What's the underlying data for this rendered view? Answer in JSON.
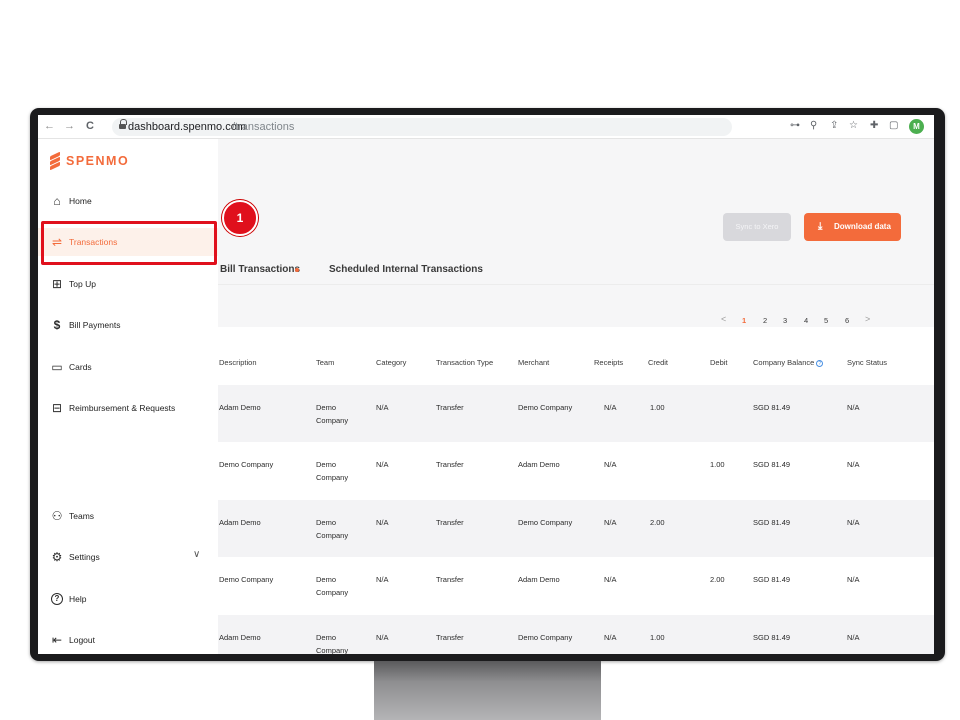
{
  "browser": {
    "url_domain": "dashboard.spenmo.com",
    "url_path": "/transactions",
    "back_glyph": "←",
    "forward_glyph": "→",
    "reload_glyph": "C",
    "profile_initial": "M",
    "key_glyph": "⊶",
    "zoom_glyph": "⚲",
    "share_glyph": "⇪",
    "star_glyph": "☆",
    "ext_glyph": "✚",
    "window_glyph": "▢"
  },
  "brand": {
    "name": "SPENMO",
    "color": "#f36b3b"
  },
  "sidebar": {
    "items": [
      {
        "label": "Home",
        "icon": "home-icon",
        "glyph": "⌂"
      },
      {
        "label": "Transactions",
        "icon": "transfer-arrows-icon",
        "glyph": "⇌",
        "active": true
      },
      {
        "label": "Top Up",
        "icon": "top-up-icon",
        "glyph": "⊞"
      },
      {
        "label": "Bill Payments",
        "icon": "bill-icon",
        "glyph": "$"
      },
      {
        "label": "Cards",
        "icon": "card-icon",
        "glyph": "▭"
      },
      {
        "label": "Reimbursement & Requests",
        "icon": "reimbursement-icon",
        "glyph": "⊟"
      }
    ],
    "bottom_items": [
      {
        "label": "Teams",
        "icon": "teams-icon",
        "glyph": "⚇"
      },
      {
        "label": "Settings",
        "icon": "settings-icon",
        "glyph": "⚙",
        "chevron": "∨"
      },
      {
        "label": "Help",
        "icon": "help-icon",
        "glyph": "?"
      },
      {
        "label": "Logout",
        "icon": "logout-icon",
        "glyph": "⇤"
      }
    ]
  },
  "header": {
    "sync_label": "Sync to Xero",
    "download_label": "Download data",
    "download_glyph": "⤓"
  },
  "tabs": [
    {
      "label": "Bill Transactions"
    },
    {
      "label": "Scheduled Internal Transactions"
    }
  ],
  "pagination": {
    "prev": "<",
    "next": ">",
    "pages": [
      "1",
      "2",
      "3",
      "4",
      "5",
      "6"
    ],
    "current": "1"
  },
  "table": {
    "columns": [
      "Description",
      "Team",
      "Category",
      "Transaction Type",
      "Merchant",
      "Receipts",
      "Credit",
      "Debit",
      "Company Balance",
      "Sync Status"
    ],
    "rows": [
      {
        "description": "Adam Demo",
        "team1": "Demo",
        "team2": "Company",
        "category": "N/A",
        "type": "Transfer",
        "merchant": "Demo Company",
        "receipts": "N/A",
        "credit": "1.00",
        "debit": "",
        "balance": "SGD 81.49",
        "sync": "N/A"
      },
      {
        "description": "Demo Company",
        "team1": "Demo",
        "team2": "Company",
        "category": "N/A",
        "type": "Transfer",
        "merchant": "Adam Demo",
        "receipts": "N/A",
        "credit": "",
        "debit": "1.00",
        "balance": "SGD 81.49",
        "sync": "N/A"
      },
      {
        "description": "Adam Demo",
        "team1": "Demo",
        "team2": "Company",
        "category": "N/A",
        "type": "Transfer",
        "merchant": "Demo Company",
        "receipts": "N/A",
        "credit": "2.00",
        "debit": "",
        "balance": "SGD 81.49",
        "sync": "N/A"
      },
      {
        "description": "Demo Company",
        "team1": "Demo",
        "team2": "Company",
        "category": "N/A",
        "type": "Transfer",
        "merchant": "Adam Demo",
        "receipts": "N/A",
        "credit": "",
        "debit": "2.00",
        "balance": "SGD 81.49",
        "sync": "N/A"
      },
      {
        "description": "Adam Demo",
        "team1": "Demo",
        "team2": "Company",
        "category": "N/A",
        "type": "Transfer",
        "merchant": "Demo Company",
        "receipts": "N/A",
        "credit": "1.00",
        "debit": "",
        "balance": "SGD 81.49",
        "sync": "N/A"
      }
    ]
  },
  "annotation": {
    "step_number": "1",
    "highlight_color": "#e0101c"
  }
}
